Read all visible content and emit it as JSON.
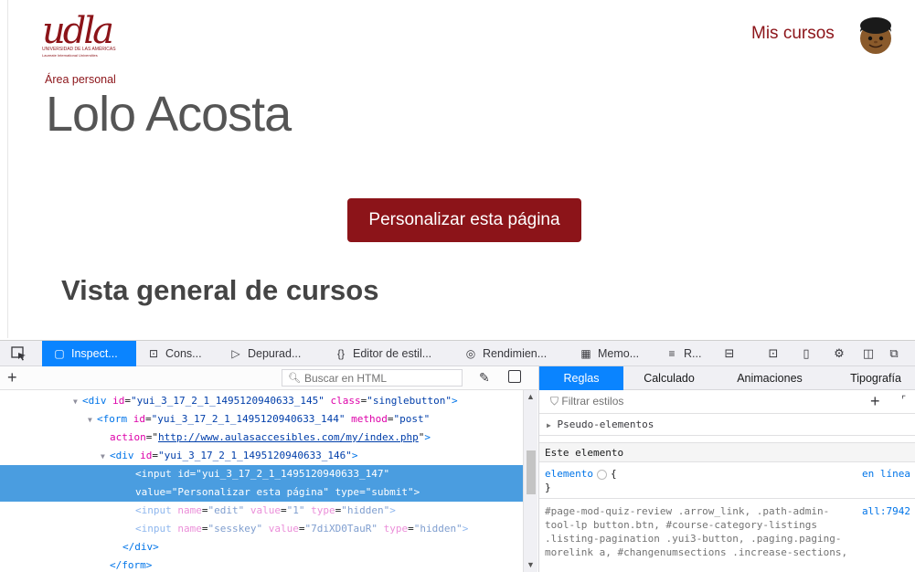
{
  "header": {
    "logo_text": "udla",
    "logo_tagline_1": "UNIVERSIDAD DE LAS AMÉRICAS",
    "logo_tagline_2": "Laureate International Universities",
    "mis_cursos": "Mis cursos"
  },
  "page": {
    "breadcrumb": "Área personal",
    "user_name": "Lolo Acosta",
    "customize_button": "Personalizar esta página",
    "section_title": "Vista general de cursos"
  },
  "devtools": {
    "tabs": [
      "Inspect...",
      "Cons...",
      "Depurad...",
      "Editor de estil...",
      "Rendimien...",
      "Memo...",
      "R..."
    ],
    "search_placeholder": "Buscar en HTML",
    "markup_lines": [
      {
        "parts": [
          {
            "c": "tag",
            "t": "<div "
          },
          {
            "c": "attr",
            "t": "id"
          },
          {
            "c": "plain",
            "t": "="
          },
          {
            "c": "val",
            "t": "\"yui_3_17_2_1_1495120940633_145\""
          },
          {
            "c": "plain",
            "t": " "
          },
          {
            "c": "attr",
            "t": "class"
          },
          {
            "c": "plain",
            "t": "="
          },
          {
            "c": "val",
            "t": "\"singlebutton\""
          },
          {
            "c": "tag",
            "t": ">"
          }
        ]
      },
      {
        "parts": [
          {
            "c": "tag",
            "t": "<form "
          },
          {
            "c": "attr",
            "t": "id"
          },
          {
            "c": "plain",
            "t": "="
          },
          {
            "c": "val",
            "t": "\"yui_3_17_2_1_1495120940633_144\""
          },
          {
            "c": "plain",
            "t": " "
          },
          {
            "c": "attr",
            "t": "method"
          },
          {
            "c": "plain",
            "t": "="
          },
          {
            "c": "val",
            "t": "\"post\""
          }
        ]
      },
      {
        "parts": [
          {
            "c": "attr",
            "t": "action"
          },
          {
            "c": "plain",
            "t": "=\""
          },
          {
            "c": "link",
            "t": "http://www.aulasaccesibles.com/my/index.php"
          },
          {
            "c": "plain",
            "t": "\""
          },
          {
            "c": "tag",
            "t": ">"
          }
        ]
      },
      {
        "parts": [
          {
            "c": "tag",
            "t": "<div "
          },
          {
            "c": "attr",
            "t": "id"
          },
          {
            "c": "plain",
            "t": "="
          },
          {
            "c": "val",
            "t": "\"yui_3_17_2_1_1495120940633_146\""
          },
          {
            "c": "tag",
            "t": ">"
          }
        ]
      },
      {
        "parts": [
          {
            "c": "tag",
            "t": "<input "
          },
          {
            "c": "attr",
            "t": "id"
          },
          {
            "c": "plain",
            "t": "="
          },
          {
            "c": "val",
            "t": "\"yui_3_17_2_1_1495120940633_147\""
          }
        ]
      },
      {
        "parts": [
          {
            "c": "attr",
            "t": "value"
          },
          {
            "c": "plain",
            "t": "="
          },
          {
            "c": "val",
            "t": "\"Personalizar esta página\""
          },
          {
            "c": "plain",
            "t": " "
          },
          {
            "c": "attr",
            "t": "type"
          },
          {
            "c": "plain",
            "t": "="
          },
          {
            "c": "val",
            "t": "\"submit\""
          },
          {
            "c": "tag",
            "t": ">"
          }
        ]
      },
      {
        "parts": [
          {
            "c": "tag",
            "t": "<input "
          },
          {
            "c": "attr",
            "t": "name"
          },
          {
            "c": "plain",
            "t": "="
          },
          {
            "c": "val",
            "t": "\"edit\""
          },
          {
            "c": "plain",
            "t": " "
          },
          {
            "c": "attr",
            "t": "value"
          },
          {
            "c": "plain",
            "t": "="
          },
          {
            "c": "val",
            "t": "\"1\""
          },
          {
            "c": "plain",
            "t": " "
          },
          {
            "c": "attr",
            "t": "type"
          },
          {
            "c": "plain",
            "t": "="
          },
          {
            "c": "val",
            "t": "\"hidden\""
          },
          {
            "c": "tag",
            "t": ">"
          }
        ]
      },
      {
        "parts": [
          {
            "c": "tag",
            "t": "<input "
          },
          {
            "c": "attr",
            "t": "name"
          },
          {
            "c": "plain",
            "t": "="
          },
          {
            "c": "val",
            "t": "\"sesskey\""
          },
          {
            "c": "plain",
            "t": " "
          },
          {
            "c": "attr",
            "t": "value"
          },
          {
            "c": "plain",
            "t": "="
          },
          {
            "c": "val",
            "t": "\"7diXD0TauR\""
          },
          {
            "c": "plain",
            "t": " "
          },
          {
            "c": "attr",
            "t": "type"
          },
          {
            "c": "plain",
            "t": "="
          },
          {
            "c": "val",
            "t": "\"hidden\""
          },
          {
            "c": "tag",
            "t": ">"
          }
        ]
      },
      {
        "parts": [
          {
            "c": "tag",
            "t": "</div>"
          }
        ]
      },
      {
        "parts": [
          {
            "c": "tag",
            "t": "</form>"
          }
        ]
      }
    ],
    "rules_tabs": [
      "Reglas",
      "Calculado",
      "Animaciones",
      "Tipografía"
    ],
    "filter_placeholder": "Filtrar estilos",
    "pseudo_label": "Pseudo-elementos",
    "este_elemento": "Este elemento",
    "element_selector": "elemento",
    "element_open": "{",
    "element_close": "}",
    "element_source": "en línea",
    "rule_selector_lines": [
      "#page-mod-quiz-review .arrow_link, .path-admin-",
      "tool-lp button.btn, #course-category-listings",
      ".listing-pagination .yui3-button, .paging.paging-",
      "morelink a, #changenumsections .increase-sections,"
    ],
    "rule_source": "all:7942"
  },
  "colors": {
    "brand": "#8c1419",
    "devtools_accent": "#0a84ff",
    "selection": "#4a9de0"
  }
}
